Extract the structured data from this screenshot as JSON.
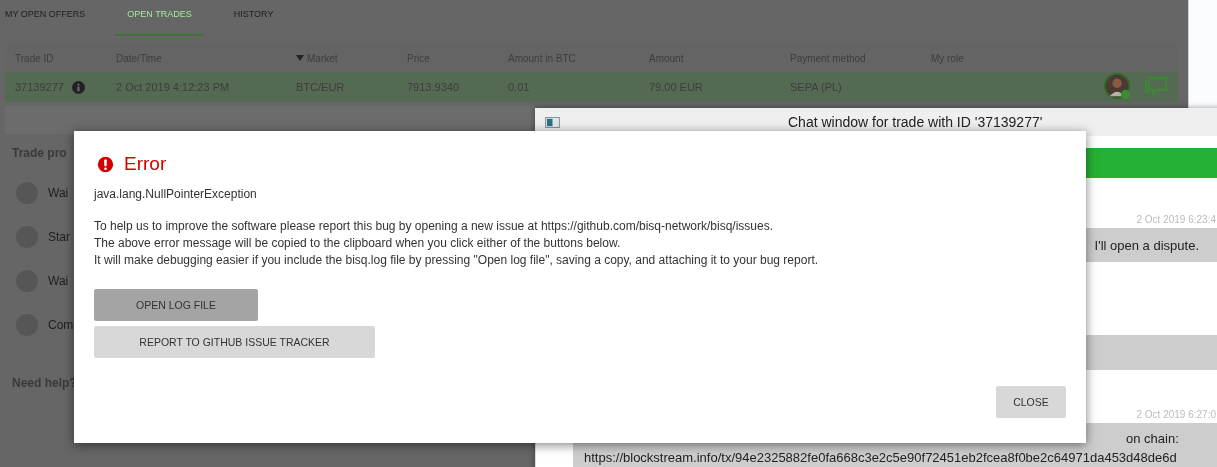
{
  "tabs": [
    {
      "label": "MY OPEN OFFERS",
      "selected": false
    },
    {
      "label": "OPEN TRADES",
      "selected": true
    },
    {
      "label": "HISTORY",
      "selected": false
    }
  ],
  "table": {
    "columns": [
      {
        "label": "Trade ID",
        "sorted": false
      },
      {
        "label": "Date/Time",
        "sorted": false
      },
      {
        "label": "Market",
        "sorted": true
      },
      {
        "label": "Price",
        "sorted": false
      },
      {
        "label": "Amount in BTC",
        "sorted": false
      },
      {
        "label": "Amount",
        "sorted": false
      },
      {
        "label": "Payment method",
        "sorted": false
      },
      {
        "label": "My role",
        "sorted": false
      }
    ],
    "rows": [
      {
        "cells": [
          "37139277",
          "2 Oct 2019 4:12:23 PM",
          "BTC/EUR",
          "7913.9340",
          "0.01",
          "79.00 EUR",
          "SEPA (PL)",
          ""
        ],
        "selected": true
      }
    ]
  },
  "trade_process": {
    "title": "Trade pro",
    "steps": [
      "Wai",
      "Star",
      "Wai",
      "Com"
    ]
  },
  "help": {
    "title": "Need help?"
  },
  "chat_window": {
    "title": "Chat window for trade with ID '37139277'",
    "messages": [
      {
        "time": "2 Oct 2019 6:23:4",
        "lines": [
          "I'll open a dispute."
        ]
      },
      {
        "time": "2 Oct 2019 6:27:0",
        "lines": [
          "on chain:",
          "https://blockstream.info/tx/94e2325882fe0fa668c3e2c5e90f72451eb2fcea8f0be2c64971da453d48de6d"
        ]
      }
    ]
  },
  "dialog": {
    "title": "Error",
    "exception": "java.lang.NullPointerException",
    "message": [
      "To help us to improve the software please report this bug by opening a new issue at https://github.com/bisq-network/bisq/issues.",
      "The above error message will be copied to the clipboard when you click either of the buttons below.",
      "It will make debugging easier if you include the bisq.log file by pressing \"Open log file\", saving a copy, and attaching it to your bug report."
    ],
    "buttons": [
      {
        "label": "OPEN LOG FILE",
        "kind": "dark"
      },
      {
        "label": "REPORT TO GITHUB ISSUE TRACKER",
        "kind": "light"
      }
    ],
    "close": "CLOSE"
  }
}
